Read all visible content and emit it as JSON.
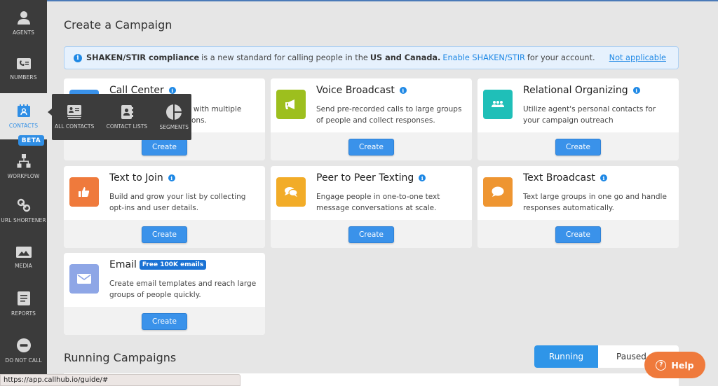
{
  "sidebar": {
    "items": [
      {
        "label": "AGENTS",
        "icon": "person-icon"
      },
      {
        "label": "NUMBERS",
        "icon": "phone-list-icon"
      },
      {
        "label": "CONTACTS",
        "icon": "contacts-calendar-icon",
        "active": true
      },
      {
        "label": "WORKFLOW",
        "icon": "workflow-icon"
      },
      {
        "label": "URL SHORTENER",
        "icon": "link-icon"
      },
      {
        "label": "MEDIA",
        "icon": "image-icon"
      },
      {
        "label": "REPORTS",
        "icon": "document-icon"
      },
      {
        "label": "DO NOT CALL",
        "icon": "minus-circle-icon"
      }
    ],
    "beta_badge": "BETA"
  },
  "contacts_popover": {
    "items": [
      {
        "label": "ALL CONTACTS",
        "icon": "address-card-icon"
      },
      {
        "label": "CONTACT LISTS",
        "icon": "address-book-icon"
      },
      {
        "label": "SEGMENTS",
        "icon": "pie-segments-icon"
      }
    ]
  },
  "main": {
    "title": "Create a Campaign",
    "notice": {
      "bold_lead": "SHAKEN/STIR compliance",
      "text1": "is a new standard for calling people in the",
      "bold_region": "US and Canada.",
      "link": "Enable SHAKEN/STIR",
      "text2": "for your account.",
      "dismiss": "Not applicable"
    },
    "cards": [
      {
        "title": "Call Center",
        "desc": "Make calls to contacts with multiple agents and conversations.",
        "color": "#3a92ea",
        "button": "Create"
      },
      {
        "title": "Voice Broadcast",
        "desc": "Send pre-recorded calls to large groups of people and collect responses.",
        "color": "#9dbf1e",
        "button": "Create"
      },
      {
        "title": "Relational Organizing",
        "desc": "Utilize agent's personal contacts for your campaign outreach",
        "color": "#1fbfb8",
        "button": "Create"
      },
      {
        "title": "Text to Join",
        "desc": "Build and grow your list by collecting opt-ins and user details.",
        "color": "#ef7a3c",
        "button": "Create"
      },
      {
        "title": "Peer to Peer Texting",
        "desc": "Engage people in one-to-one text message conversations at scale.",
        "color": "#f2ac28",
        "button": "Create"
      },
      {
        "title": "Text Broadcast",
        "desc": "Text large groups in one go and handle responses automatically.",
        "color": "#ee9531",
        "button": "Create"
      },
      {
        "title": "Email",
        "badge": "Free 100K emails",
        "desc": "Create email templates and reach large groups of people quickly.",
        "color": "#8ea6e6",
        "button": "Create"
      }
    ],
    "running_title": "Running Campaigns",
    "toggle": {
      "running": "Running",
      "paused": "Paused"
    }
  },
  "help_button": "Help",
  "status_url": "https://app.callhub.io/guide/#"
}
